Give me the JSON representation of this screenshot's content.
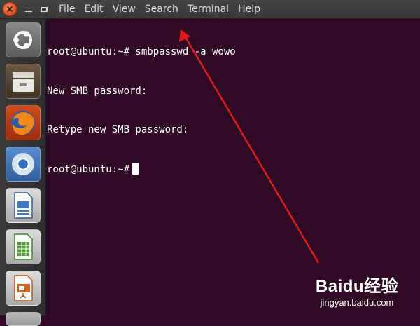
{
  "menubar": {
    "items": [
      "File",
      "Edit",
      "View",
      "Search",
      "Terminal",
      "Help"
    ]
  },
  "launcher": {
    "items": [
      "ubuntu-dash",
      "files",
      "firefox",
      "chromium",
      "libreoffice-writer",
      "libreoffice-calc",
      "libreoffice-impress"
    ]
  },
  "terminal": {
    "lines": [
      "root@ubuntu:~# smbpasswd -a wowo",
      "New SMB password:",
      "Retype new SMB password:"
    ],
    "prompt": "root@ubuntu:~#"
  },
  "watermark": {
    "logo": "Baidu经验",
    "url": "jingyan.baidu.com"
  },
  "colors": {
    "terminal_bg": "#300a24",
    "terminal_fg": "#ffffff",
    "annotation_arrow": "#e01a1a"
  }
}
